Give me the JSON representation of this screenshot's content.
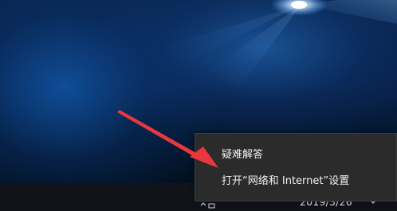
{
  "context_menu": {
    "items": [
      {
        "label": "疑难解答"
      },
      {
        "label": "打开“网络和 Internet”设置"
      }
    ]
  },
  "taskbar": {
    "date": "2019/3/26"
  },
  "annotation": {
    "arrow_color": "#e8383d"
  },
  "colors": {
    "menu_background": "#2b2b2b",
    "taskbar_background": "#101418",
    "wallpaper_base": "#072046"
  }
}
